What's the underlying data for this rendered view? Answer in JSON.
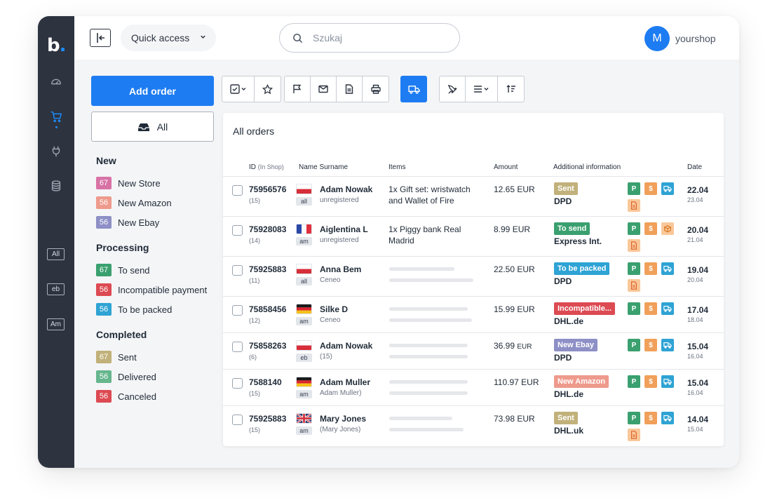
{
  "brand": {
    "logo_text": "b",
    "accent": "#1d7cf2"
  },
  "rail": {
    "icons": [
      "dashboard-icon",
      "cart-icon",
      "plug-icon",
      "database-icon"
    ],
    "sources": [
      "All",
      "eb",
      "Am"
    ]
  },
  "topbar": {
    "quick_access_label": "Quick access",
    "search_placeholder": "Szukaj",
    "user_initial": "M",
    "user_name": "yourshop"
  },
  "actions": {
    "add_order_label": "Add order",
    "all_label": "All"
  },
  "toolbar_groups": [
    [
      "checkbox-select-icon",
      "star-icon"
    ],
    [
      "flag-icon",
      "mail-icon",
      "document-icon",
      "print-icon"
    ],
    [
      "truck-icon"
    ],
    [
      "pin-icon",
      "list-icon",
      "sort-icon"
    ]
  ],
  "status_sections": [
    {
      "title": "New",
      "items": [
        {
          "count": "67",
          "label": "New Store",
          "color": "#d872a5"
        },
        {
          "count": "56",
          "label": "New Amazon",
          "color": "#ee9a8c"
        },
        {
          "count": "56",
          "label": "New Ebay",
          "color": "#8d8fc6"
        }
      ]
    },
    {
      "title": "Processing",
      "items": [
        {
          "count": "67",
          "label": "To send",
          "color": "#3aa06f"
        },
        {
          "count": "56",
          "label": "Incompatible payment",
          "color": "#dc4a52"
        },
        {
          "count": "56",
          "label": "To be packed",
          "color": "#2ea3d4"
        }
      ]
    },
    {
      "title": "Completed",
      "items": [
        {
          "count": "67",
          "label": "Sent",
          "color": "#c1b17a"
        },
        {
          "count": "56",
          "label": "Delivered",
          "color": "#66b68e"
        },
        {
          "count": "56",
          "label": "Canceled",
          "color": "#dc4a52"
        }
      ]
    }
  ],
  "orders_panel": {
    "title": "All orders",
    "columns": {
      "id": "ID",
      "id_sub": "(In Shop)",
      "name": "Name Surname",
      "items": "Items",
      "amount": "Amount",
      "info": "Additional information",
      "date": "Date"
    }
  },
  "orders": [
    {
      "id": "75956576",
      "shop_id": "(15)",
      "flag": "pl",
      "source": "all",
      "name": "Adam Nowak",
      "sub": "unregistered",
      "items": "1x Gift set: wristwatch and Wallet of Fire",
      "amount": "12.65 EUR",
      "status": "Sent",
      "status_color": "#c1b17a",
      "courier": "DPD",
      "icons": [
        "P",
        "$",
        "truck",
        "doc"
      ],
      "date": "22.04",
      "date_sub": "23.04"
    },
    {
      "id": "75928083",
      "shop_id": "(14)",
      "flag": "fr",
      "source": "am",
      "name": "Aiglentina L",
      "sub": "unregistered",
      "items": "1x Piggy bank Real Madrid",
      "amount": "8.99 EUR",
      "status": "To send",
      "status_color": "#3aa06f",
      "courier": "Express Int.",
      "icons": [
        "P",
        "$",
        "box",
        "doc"
      ],
      "date": "20.04",
      "date_sub": "21.04"
    },
    {
      "id": "75925883",
      "shop_id": "(11)",
      "flag": "pl",
      "source": "all",
      "name": "Anna Bem",
      "sub": "Ceneo",
      "items": "",
      "amount": "22.50 EUR",
      "status": "To be packed",
      "status_color": "#2ea3d4",
      "courier": "DPD",
      "icons": [
        "P",
        "$",
        "truck",
        "doc"
      ],
      "date": "19.04",
      "date_sub": "20.04"
    },
    {
      "id": "75858456",
      "shop_id": "(12)",
      "flag": "de",
      "source": "am",
      "name": "Silke D",
      "sub": "Ceneo",
      "items": "",
      "amount": "15.99 EUR",
      "status": "Incompatible...",
      "status_color": "#dc4a52",
      "courier": "DHL.de",
      "icons": [
        "P",
        "$",
        "truck"
      ],
      "date": "17.04",
      "date_sub": "18.04"
    },
    {
      "id": "75858263",
      "shop_id": "(6)",
      "flag": "pl",
      "source": "eb",
      "name": "Adam Nowak",
      "sub": "(15)",
      "items": "",
      "amount": "36.99",
      "amount_unit": "EUR",
      "status": "New Ebay",
      "status_color": "#8d8fc6",
      "courier": "DPD",
      "icons": [
        "P",
        "$",
        "truck"
      ],
      "date": "15.04",
      "date_sub": "16.04"
    },
    {
      "id": "7588140",
      "shop_id": "(15)",
      "flag": "de",
      "source": "am",
      "name": "Adam Muller",
      "sub": "Adam Muller)",
      "items": "",
      "amount": "110.97 EUR",
      "status": "New Amazon",
      "status_color": "#ee9a8c",
      "courier": "DHL.de",
      "icons": [
        "P",
        "$",
        "truck"
      ],
      "date": "15.04",
      "date_sub": "16.04"
    },
    {
      "id": "75925883",
      "shop_id": "(15)",
      "flag": "uk",
      "source": "am",
      "name": "Mary Jones",
      "sub": "(Mary Jones)",
      "items": "",
      "amount": "73.98 EUR",
      "status": "Sent",
      "status_color": "#c1b17a",
      "courier": "DHL.uk",
      "icons": [
        "P",
        "$",
        "truck",
        "doc"
      ],
      "date": "14.04",
      "date_sub": "15.04"
    }
  ]
}
